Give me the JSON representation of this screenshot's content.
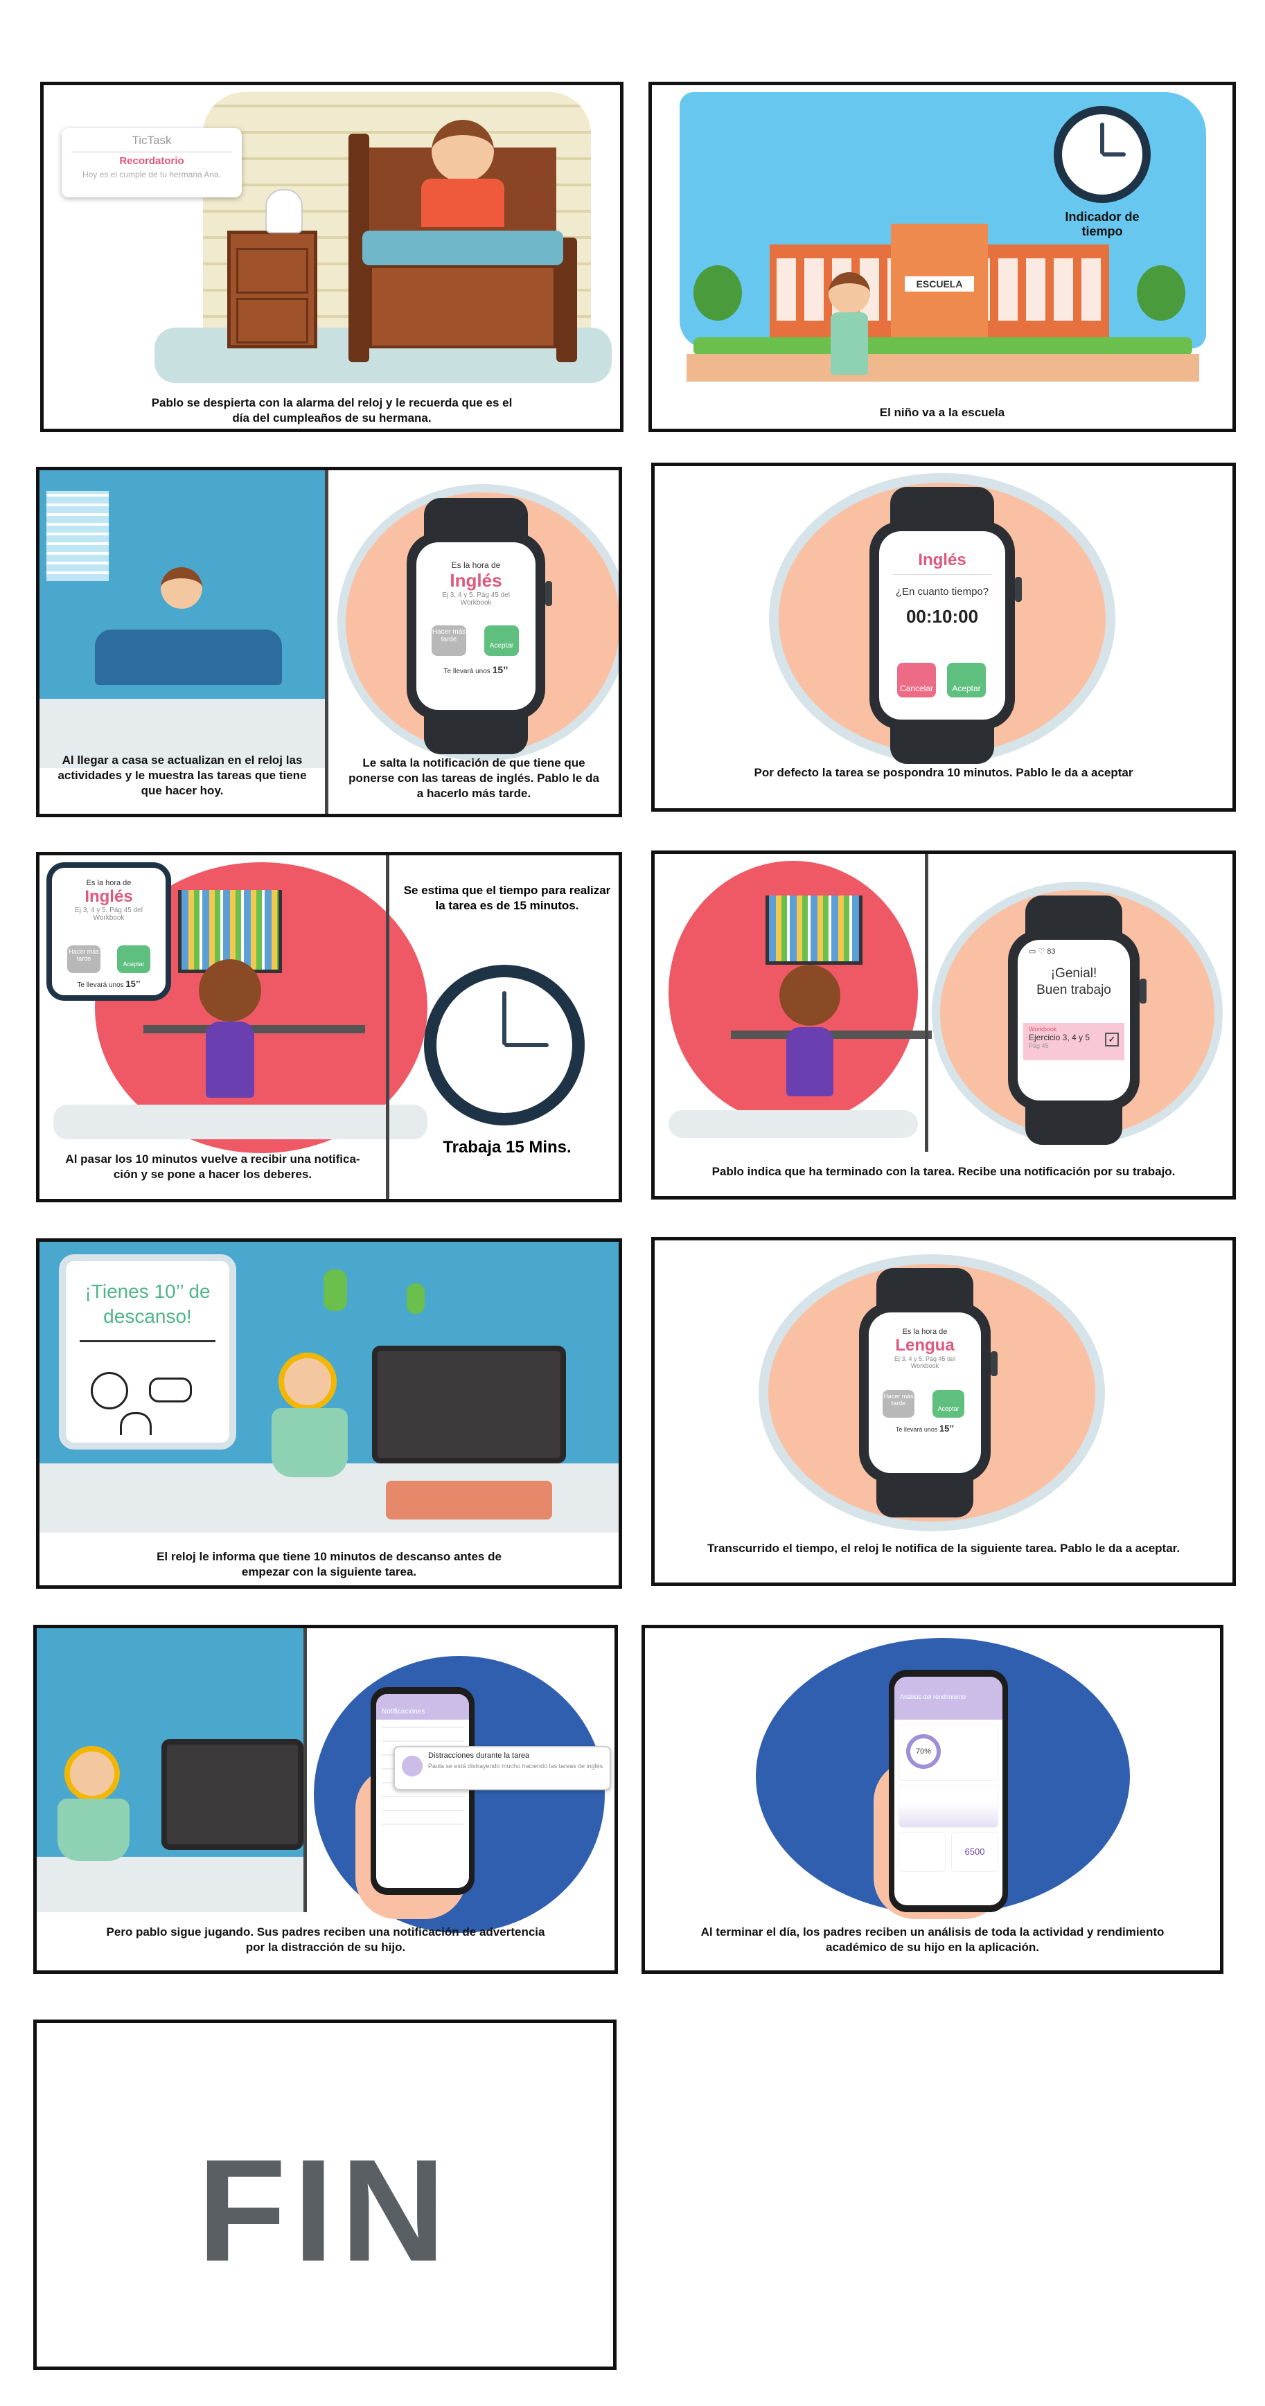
{
  "panels": {
    "p1": {
      "notification": {
        "app": "TicTask",
        "title": "Recordatorio",
        "body": "Hoy es el cumple de tu hermana Ana."
      },
      "caption": "Pablo se despierta con la alarma del reloj y le recuerda que es el día del cumpleaños de su hermana."
    },
    "p2": {
      "indicator": "Indicador de tiempo",
      "school_sign": "ESCUELA",
      "caption": "El niño va a la escuela"
    },
    "p3": {
      "caption_left": "Al llegar a casa se actualizan en el reloj las actividades y le muestra las tareas que tiene que hacer hoy.",
      "caption_right": "Le salta la notificación de que tiene que ponerse con las tareas de inglés. Pablo le da a hacerlo más tarde.",
      "watch": {
        "header": "Es la hora de",
        "subject": "Inglés",
        "detail": "Ej 3, 4 y 5. Pág 45 del Workbook",
        "later": "Hacer más tarde",
        "accept": "Aceptar",
        "estimate": "Te llevará unos",
        "minutes": "15’’"
      }
    },
    "p4": {
      "watch": {
        "subject": "Inglés",
        "question": "¿En cuanto tiempo?",
        "time": "00:10:00",
        "cancel": "Cancelar",
        "accept": "Aceptar"
      },
      "caption": "Por defecto la tarea se pospondra 10 minutos. Pablo le da a aceptar"
    },
    "p5": {
      "popup": {
        "header": "Es la hora de",
        "subject": "Inglés",
        "detail": "Ej 3, 4 y 5. Pág 45 del Workbook",
        "later": "Hacer más tarde",
        "accept": "Aceptar",
        "estimate": "Te llevará unos",
        "minutes": "15’’"
      },
      "caption_left": "Al pasar los 10 minutos vuelve a recibir una notifica-ción y se pone a hacer los deberes.",
      "estimate_text": "Se estima que el tiempo para realizar la tarea es de 15 minutos.",
      "work_label": "Trabaja 15 Mins."
    },
    "p6": {
      "watch": {
        "status": "83",
        "title": "¡Genial! Buen trabajo",
        "tag": "Workbook",
        "task": "Ejercicio 3, 4 y 5",
        "page": "Pág 45"
      },
      "caption": "Pablo indica que ha terminado con la tarea. Recibe una notificación por su trabajo."
    },
    "p7": {
      "break_card": "¡Tienes 10’’ de descanso!",
      "caption": "El reloj le informa que tiene 10 minutos de descanso antes de empezar con la siguiente tarea."
    },
    "p8": {
      "watch": {
        "header": "Es la hora de",
        "subject": "Lengua",
        "detail": "Ej 3, 4 y 5. Pág 45 del Workbook",
        "later": "Hacer más tarde",
        "accept": "Aceptar",
        "estimate": "Te llevará unos",
        "minutes": "15’’"
      },
      "caption": "Transcurrido el tiempo, el reloj le notifica de la siguiente tarea. Pablo le da a aceptar."
    },
    "p9": {
      "phone_header": "Notificaciones",
      "alert_title": "Distracciones durante la tarea",
      "alert_body": "Paula se está distrayendo mucho haciendo las tareas de inglés",
      "caption": "Pero pablo sigue jugando. Sus padres reciben una notificación de advertencia por la distracción de su hijo."
    },
    "p10": {
      "phone_header": "Análisis del rendimiento",
      "percent": "70%",
      "steps": "6500",
      "caption": "Al terminar el día, los padres reciben un análisis de toda la actividad y rendimiento académico de su hijo en la aplicación."
    },
    "p11": {
      "fin": "FIN"
    }
  }
}
